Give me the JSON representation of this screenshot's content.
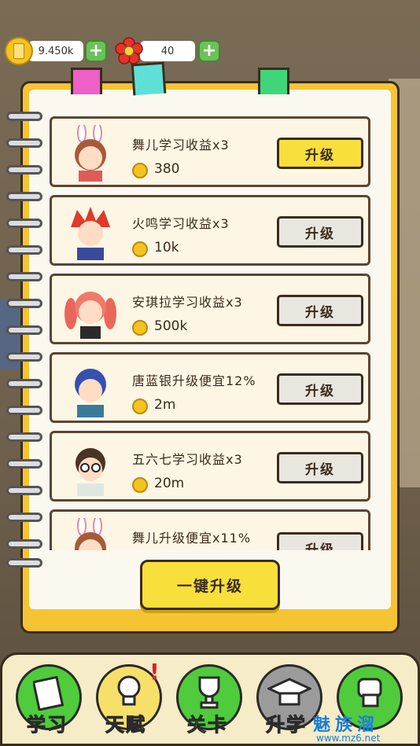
{
  "resources": {
    "coins": "9.450k",
    "flowers": "40"
  },
  "tabs": [
    {
      "color": "#ee5fc8"
    },
    {
      "color": "#5fe0d6"
    },
    {
      "color": "#3fd67a"
    }
  ],
  "upgrades": [
    {
      "title": "舞儿学习收益x3",
      "cost": "380",
      "button": "升级",
      "active": true,
      "avatar": "bunny-girl"
    },
    {
      "title": "火鸣学习收益x3",
      "cost": "10k",
      "button": "升级",
      "active": false,
      "avatar": "red-hair-boy"
    },
    {
      "title": "安琪拉学习收益x3",
      "cost": "500k",
      "button": "升级",
      "active": false,
      "avatar": "pink-twintail-girl"
    },
    {
      "title": "唐蓝银升级便宜12%",
      "cost": "2m",
      "button": "升级",
      "active": false,
      "avatar": "blue-hair-boy"
    },
    {
      "title": "五六七学习收益x3",
      "cost": "20m",
      "button": "升级",
      "active": false,
      "avatar": "glasses-boy"
    },
    {
      "title": "舞儿升级便宜x11%",
      "cost": "",
      "button": "升级",
      "active": false,
      "avatar": "bunny-girl"
    }
  ],
  "one_key_label": "一键升级",
  "nav": [
    {
      "label": "学习",
      "icon": "book-icon",
      "style": "green"
    },
    {
      "label": "天赋",
      "icon": "lightbulb-icon",
      "style": "yellow"
    },
    {
      "label": "关卡",
      "icon": "trophy-icon",
      "style": "green"
    },
    {
      "label": "升学",
      "icon": "graduation-cap-icon",
      "style": "gray"
    },
    {
      "label": "",
      "icon": "fist-icon",
      "style": "green"
    }
  ],
  "nav_alert": "!",
  "watermark": {
    "text": "魅族溜",
    "url": "www.mz6.net"
  }
}
